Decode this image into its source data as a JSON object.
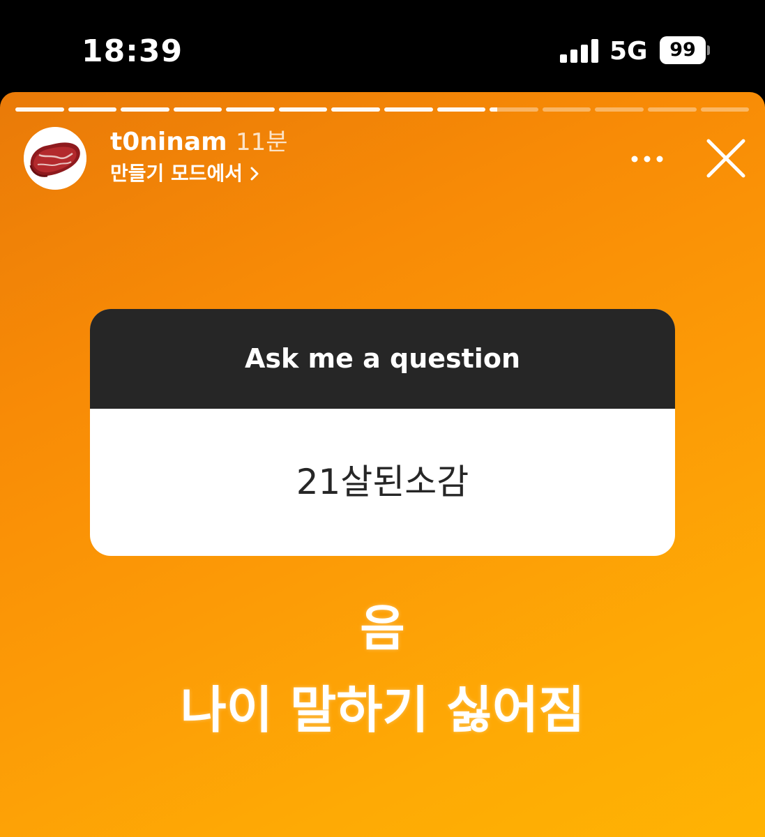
{
  "status_bar": {
    "time": "18:39",
    "network": "5G",
    "battery": "99"
  },
  "story": {
    "progress": {
      "total_segments": 14,
      "completed_segments": 9,
      "current_segment_fraction": 0.15
    },
    "author": {
      "username": "t0ninam",
      "time_ago": "11분",
      "subtitle": "만들기 모드에서",
      "avatar_icon": "steak-icon"
    },
    "question_sticker": {
      "prompt": "Ask me a question",
      "question": "21살된소감"
    },
    "answer": {
      "line1": "음",
      "line2": "나이 말하기 싫어짐"
    }
  },
  "colors": {
    "gradient_start": "#e97a08",
    "gradient_end": "#ffb303",
    "card_header": "#262626"
  }
}
